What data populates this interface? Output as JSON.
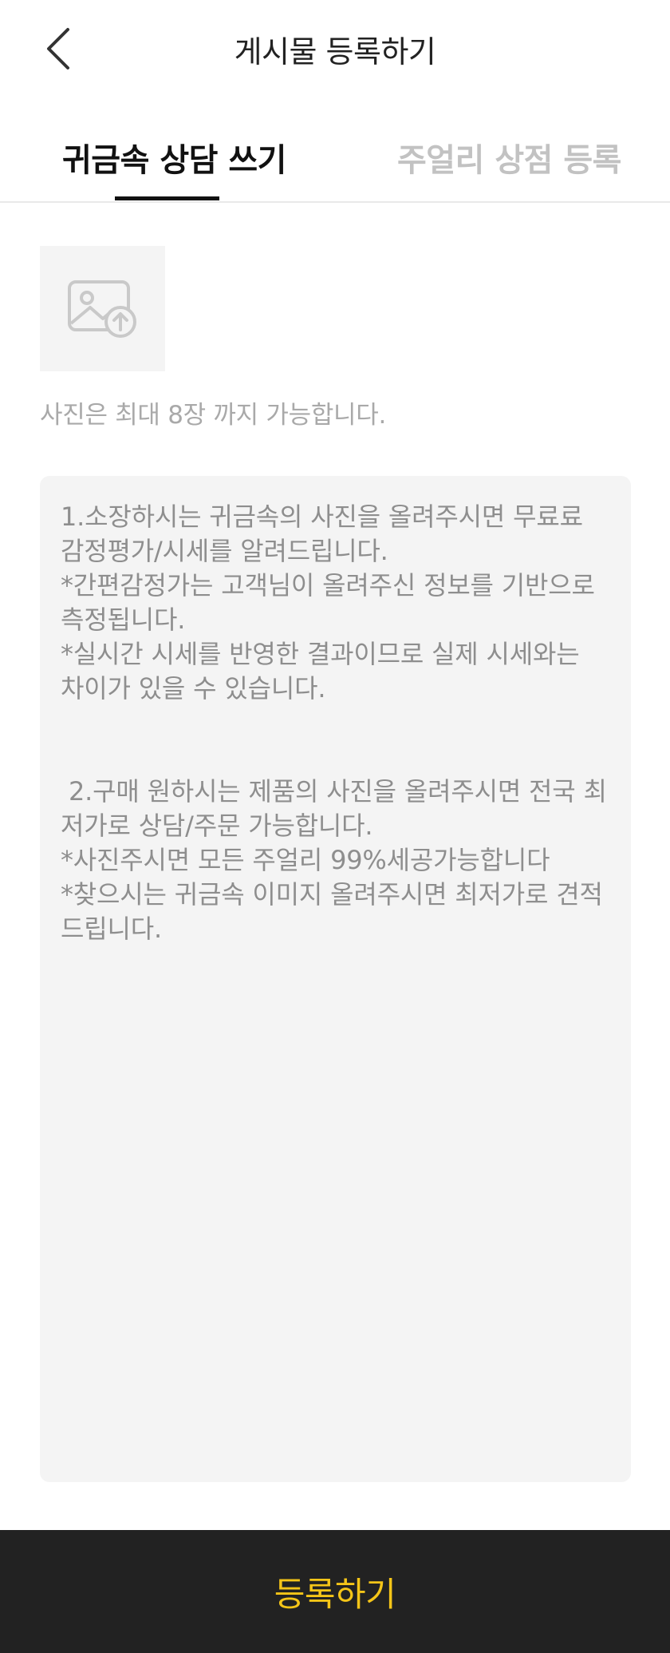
{
  "header": {
    "title": "게시물 등록하기",
    "back_icon": "chevron-left-icon"
  },
  "tabs": [
    {
      "label": "귀금속 상담 쓰기",
      "active": true
    },
    {
      "label": "주얼리 상점 등록",
      "active": false
    }
  ],
  "photo": {
    "icon": "image-upload-icon",
    "hint": "사진은 최대 8장 까지 가능합니다."
  },
  "content": {
    "placeholder": "1.소장하시는 귀금속의 사진을 올려주시면 무료료 감정평가/시세를 알려드립니다.\n*간편감정가는 고객님이 올려주신 정보를 기반으로 측정됩니다.\n*실시간 시세를 반영한 결과이므로 실제 시세와는 차이가 있을 수 있습니다.\n\n\n 2.구매 원하시는 제품의 사진을 올려주시면 전국 최저가로 상담/주문 가능합니다.\n*사진주시면 모든 주얼리 99%세공가능합니다\n*찾으시는 귀금속 이미지 올려주시면 최저가로 견적드립니다."
  },
  "submit": {
    "label": "등록하기"
  },
  "colors": {
    "accent": "#f5c518",
    "bottom_bar": "#222222",
    "inactive_tab": "#c2c2c2",
    "input_bg": "#f4f4f4"
  }
}
